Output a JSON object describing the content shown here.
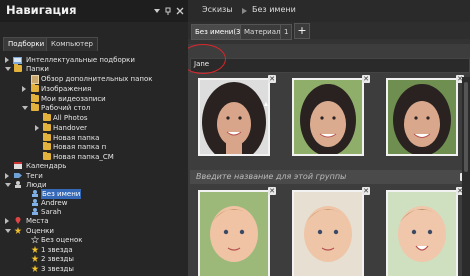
{
  "nav": {
    "title": "Навигация",
    "tabs": [
      {
        "label": "Подборки"
      },
      {
        "label": "Компьютер"
      }
    ],
    "tree": [
      {
        "label": "Интеллектуальные подборки",
        "icon": "smart-album-icon",
        "expanded": false
      },
      {
        "label": "Папки",
        "icon": "folder-icon",
        "expanded": true
      },
      {
        "label": "Обзор дополнительных папок",
        "icon": "folder-icon"
      },
      {
        "label": "Изображения",
        "icon": "folder-icon"
      },
      {
        "label": "Мои видеозаписи",
        "icon": "folder-icon"
      },
      {
        "label": "Рабочий стол",
        "icon": "folder-icon",
        "expanded": true
      },
      {
        "label": "All Photos",
        "icon": "folder-icon"
      },
      {
        "label": "Handover",
        "icon": "folder-icon"
      },
      {
        "label": "Новая папка",
        "icon": "folder-icon"
      },
      {
        "label": "Новая папка п",
        "icon": "folder-icon"
      },
      {
        "label": "Новая папка_CM",
        "icon": "folder-icon"
      },
      {
        "label": "Календарь",
        "icon": "calendar-icon"
      },
      {
        "label": "Теги",
        "icon": "tag-icon",
        "expanded": false
      },
      {
        "label": "Люди",
        "icon": "people-icon",
        "expanded": true
      },
      {
        "label": "Без имени",
        "icon": "person-icon",
        "selected": true
      },
      {
        "label": "Andrew",
        "icon": "person-icon"
      },
      {
        "label": "Sarah",
        "icon": "person-icon"
      },
      {
        "label": "Места",
        "icon": "pin-icon",
        "expanded": false
      },
      {
        "label": "Оценки",
        "icon": "star-icon",
        "expanded": true
      },
      {
        "label": "Без оценок",
        "icon": "star-outline-icon"
      },
      {
        "label": "1 звезда",
        "icon": "star-icon"
      },
      {
        "label": "2 звезды",
        "icon": "star-icon"
      },
      {
        "label": "3 звезды",
        "icon": "star-icon"
      }
    ]
  },
  "main": {
    "breadcrumb": [
      "Эскизы",
      "Без имени"
    ],
    "tabs": [
      {
        "label": "Без имени(33)",
        "active": true
      },
      {
        "label": "Материалы",
        "active": false
      },
      {
        "label": "1",
        "active": false
      }
    ],
    "add_label": "+",
    "name_field_value": "Jane",
    "group2_placeholder": "Введите название для этой группы"
  },
  "colors": {
    "accent_selection": "#3569b8",
    "annotation_circle": "#d8262b",
    "folder": "#e3b23c"
  }
}
